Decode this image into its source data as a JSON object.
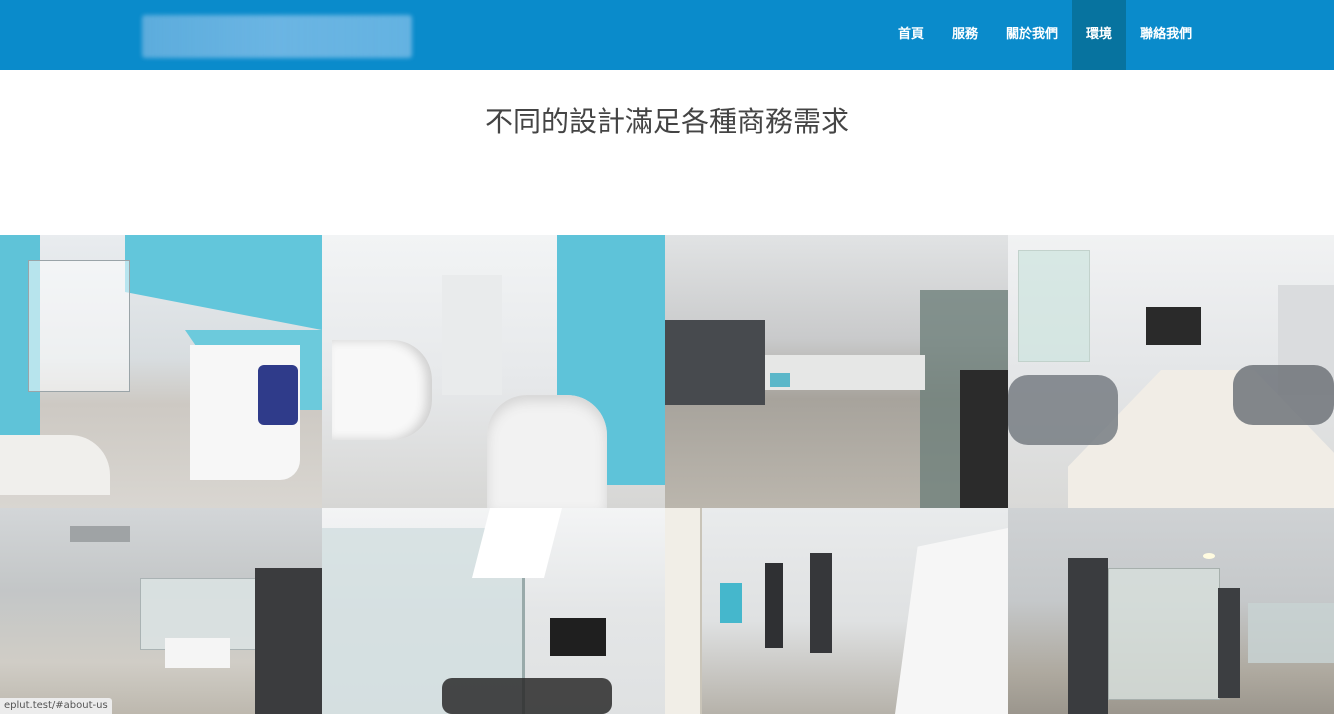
{
  "nav": {
    "items": [
      "首頁",
      "服務",
      "關於我們",
      "環境",
      "聯絡我們"
    ],
    "active": "環境"
  },
  "headline": "不同的設計滿足各種商務需求",
  "status_url": "eplut.test/#about-us",
  "colors": {
    "header": "#0a8bcb",
    "nav_active": "#07739f",
    "accent_blue": "#5ec3d9"
  }
}
